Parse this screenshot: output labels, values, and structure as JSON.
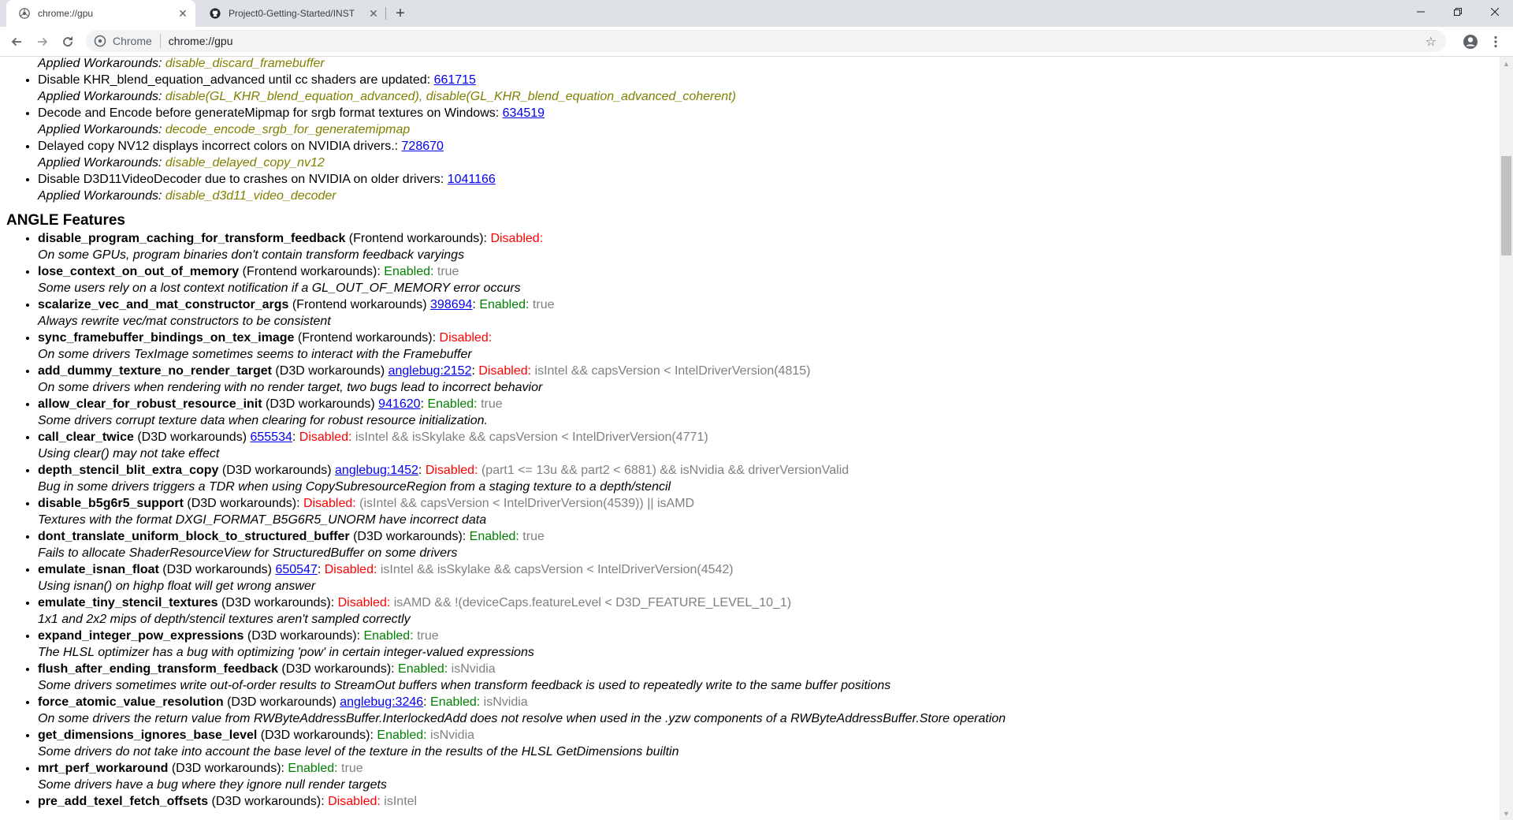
{
  "tabs": [
    {
      "title": "chrome://gpu",
      "active": true
    },
    {
      "title": "Project0-Getting-Started/INST",
      "active": false
    }
  ],
  "toolbar": {
    "chip": "Chrome",
    "url": "chrome://gpu"
  },
  "top_items": [
    {
      "desc": null,
      "bug": null,
      "workarounds": "disable_discard_framebuffer"
    },
    {
      "desc": "Disable KHR_blend_equation_advanced until cc shaders are updated: ",
      "bug": "661715",
      "workarounds": "disable(GL_KHR_blend_equation_advanced), disable(GL_KHR_blend_equation_advanced_coherent)"
    },
    {
      "desc": "Decode and Encode before generateMipmap for srgb format textures on Windows: ",
      "bug": "634519",
      "workarounds": "decode_encode_srgb_for_generatemipmap"
    },
    {
      "desc": "Delayed copy NV12 displays incorrect colors on NVIDIA drivers.: ",
      "bug": "728670",
      "workarounds": "disable_delayed_copy_nv12"
    },
    {
      "desc": "Disable D3D11VideoDecoder due to crashes on NVIDIA on older drivers: ",
      "bug": "1041166",
      "workarounds": "disable_d3d11_video_decoder"
    }
  ],
  "applied_label": "Applied Workarounds: ",
  "angle": {
    "heading": "ANGLE Features",
    "features": [
      {
        "name": "disable_program_caching_for_transform_feedback",
        "category": " (Frontend workarounds)",
        "bug": null,
        "status": "Disabled",
        "condition": "",
        "desc": "On some GPUs, program binaries don't contain transform feedback varyings"
      },
      {
        "name": "lose_context_on_out_of_memory",
        "category": " (Frontend workarounds)",
        "bug": null,
        "status": "Enabled",
        "condition": "true",
        "desc": "Some users rely on a lost context notification if a GL_OUT_OF_MEMORY error occurs"
      },
      {
        "name": "scalarize_vec_and_mat_constructor_args",
        "category": " (Frontend workarounds) ",
        "bug": "398694",
        "status": "Enabled",
        "condition": "true",
        "desc": "Always rewrite vec/mat constructors to be consistent"
      },
      {
        "name": "sync_framebuffer_bindings_on_tex_image",
        "category": " (Frontend workarounds)",
        "bug": null,
        "status": "Disabled",
        "condition": "",
        "desc": "On some drivers TexImage sometimes seems to interact with the Framebuffer"
      },
      {
        "name": "add_dummy_texture_no_render_target",
        "category": " (D3D workarounds) ",
        "bug": "anglebug:2152",
        "status": "Disabled",
        "condition": "isIntel && capsVersion < IntelDriverVersion(4815)",
        "desc": "On some drivers when rendering with no render target, two bugs lead to incorrect behavior"
      },
      {
        "name": "allow_clear_for_robust_resource_init",
        "category": " (D3D workarounds) ",
        "bug": "941620",
        "status": "Enabled",
        "condition": "true",
        "desc": "Some drivers corrupt texture data when clearing for robust resource initialization."
      },
      {
        "name": "call_clear_twice",
        "category": " (D3D workarounds) ",
        "bug": "655534",
        "status": "Disabled",
        "condition": "isIntel && isSkylake && capsVersion < IntelDriverVersion(4771)",
        "desc": "Using clear() may not take effect"
      },
      {
        "name": "depth_stencil_blit_extra_copy",
        "category": " (D3D workarounds) ",
        "bug": "anglebug:1452",
        "status": "Disabled",
        "condition": "(part1 <= 13u && part2 < 6881) && isNvidia && driverVersionValid",
        "desc": "Bug in some drivers triggers a TDR when using CopySubresourceRegion from a staging texture to a depth/stencil"
      },
      {
        "name": "disable_b5g6r5_support",
        "category": " (D3D workarounds)",
        "bug": null,
        "status": "Disabled",
        "condition": "(isIntel && capsVersion < IntelDriverVersion(4539)) || isAMD",
        "desc": "Textures with the format DXGI_FORMAT_B5G6R5_UNORM have incorrect data"
      },
      {
        "name": "dont_translate_uniform_block_to_structured_buffer",
        "category": " (D3D workarounds)",
        "bug": null,
        "status": "Enabled",
        "condition": "true",
        "desc": "Fails to allocate ShaderResourceView for StructuredBuffer on some drivers"
      },
      {
        "name": "emulate_isnan_float",
        "category": " (D3D workarounds) ",
        "bug": "650547",
        "status": "Disabled",
        "condition": "isIntel && isSkylake && capsVersion < IntelDriverVersion(4542)",
        "desc": "Using isnan() on highp float will get wrong answer"
      },
      {
        "name": "emulate_tiny_stencil_textures",
        "category": " (D3D workarounds)",
        "bug": null,
        "status": "Disabled",
        "condition": "isAMD && !(deviceCaps.featureLevel < D3D_FEATURE_LEVEL_10_1)",
        "desc": "1x1 and 2x2 mips of depth/stencil textures aren't sampled correctly"
      },
      {
        "name": "expand_integer_pow_expressions",
        "category": " (D3D workarounds)",
        "bug": null,
        "status": "Enabled",
        "condition": "true",
        "desc": "The HLSL optimizer has a bug with optimizing 'pow' in certain integer-valued expressions"
      },
      {
        "name": "flush_after_ending_transform_feedback",
        "category": " (D3D workarounds)",
        "bug": null,
        "status": "Enabled",
        "condition": "isNvidia",
        "desc": "Some drivers sometimes write out-of-order results to StreamOut buffers when transform feedback is used to repeatedly write to the same buffer positions"
      },
      {
        "name": "force_atomic_value_resolution",
        "category": " (D3D workarounds) ",
        "bug": "anglebug:3246",
        "status": "Enabled",
        "condition": "isNvidia",
        "desc": "On some drivers the return value from RWByteAddressBuffer.InterlockedAdd does not resolve when used in the .yzw components of a RWByteAddressBuffer.Store operation"
      },
      {
        "name": "get_dimensions_ignores_base_level",
        "category": " (D3D workarounds)",
        "bug": null,
        "status": "Enabled",
        "condition": "isNvidia",
        "desc": "Some drivers do not take into account the base level of the texture in the results of the HLSL GetDimensions builtin"
      },
      {
        "name": "mrt_perf_workaround",
        "category": " (D3D workarounds)",
        "bug": null,
        "status": "Enabled",
        "condition": "true",
        "desc": "Some drivers have a bug where they ignore null render targets"
      },
      {
        "name": "pre_add_texel_fetch_offsets",
        "category": " (D3D workarounds)",
        "bug": null,
        "status": "Disabled",
        "condition": "isIntel",
        "desc": ""
      }
    ]
  }
}
